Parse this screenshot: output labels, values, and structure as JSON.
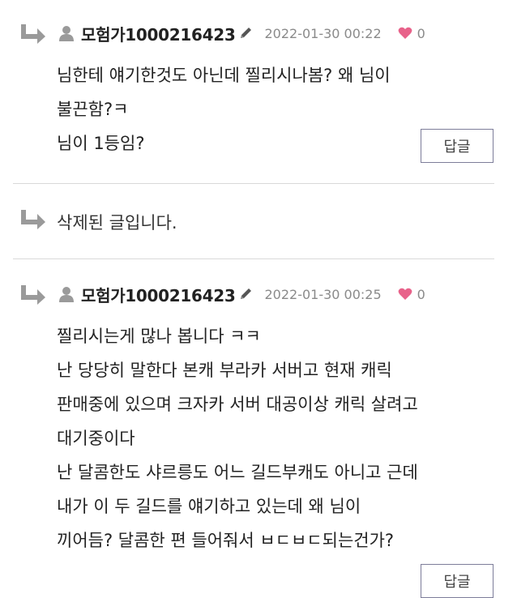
{
  "comments": [
    {
      "username": "모험가1000216423",
      "date": "2022-01-30 00:22",
      "likes": "0",
      "lines": [
        "님한테 얘기한것도 아닌데 찔리시나봄? 왜 님이",
        "불끈함?ㅋ",
        "님이 1등임?"
      ],
      "reply_label": "답글"
    },
    {
      "deleted_text": "삭제된 글입니다."
    },
    {
      "username": "모험가1000216423",
      "date": "2022-01-30 00:25",
      "likes": "0",
      "lines": [
        "찔리시는게 많나 봅니다 ㅋㅋ",
        "난 당당히 말한다 본캐 부라카 서버고 현재 캐릭",
        "판매중에 있으며 크자카 서버 대공이상 캐릭 살려고",
        "대기중이다",
        "난 달콤한도 샤르릉도 어느 길드부캐도 아니고 근데",
        "내가 이 두 길드를 얘기하고 있는데 왜 님이",
        "끼어듬? 달콤한 편 들어줘서 ㅂㄷㅂㄷ되는건가?"
      ],
      "reply_label": "답글"
    }
  ],
  "colors": {
    "heart": "#e8628a",
    "meta": "#8a8a8a",
    "divider": "#d9d9d9",
    "button_border": "#7d7d9a"
  },
  "icons": {
    "reply": "reply-arrow-icon",
    "user": "user-icon",
    "edit": "pencil-icon",
    "like": "heart-icon"
  }
}
